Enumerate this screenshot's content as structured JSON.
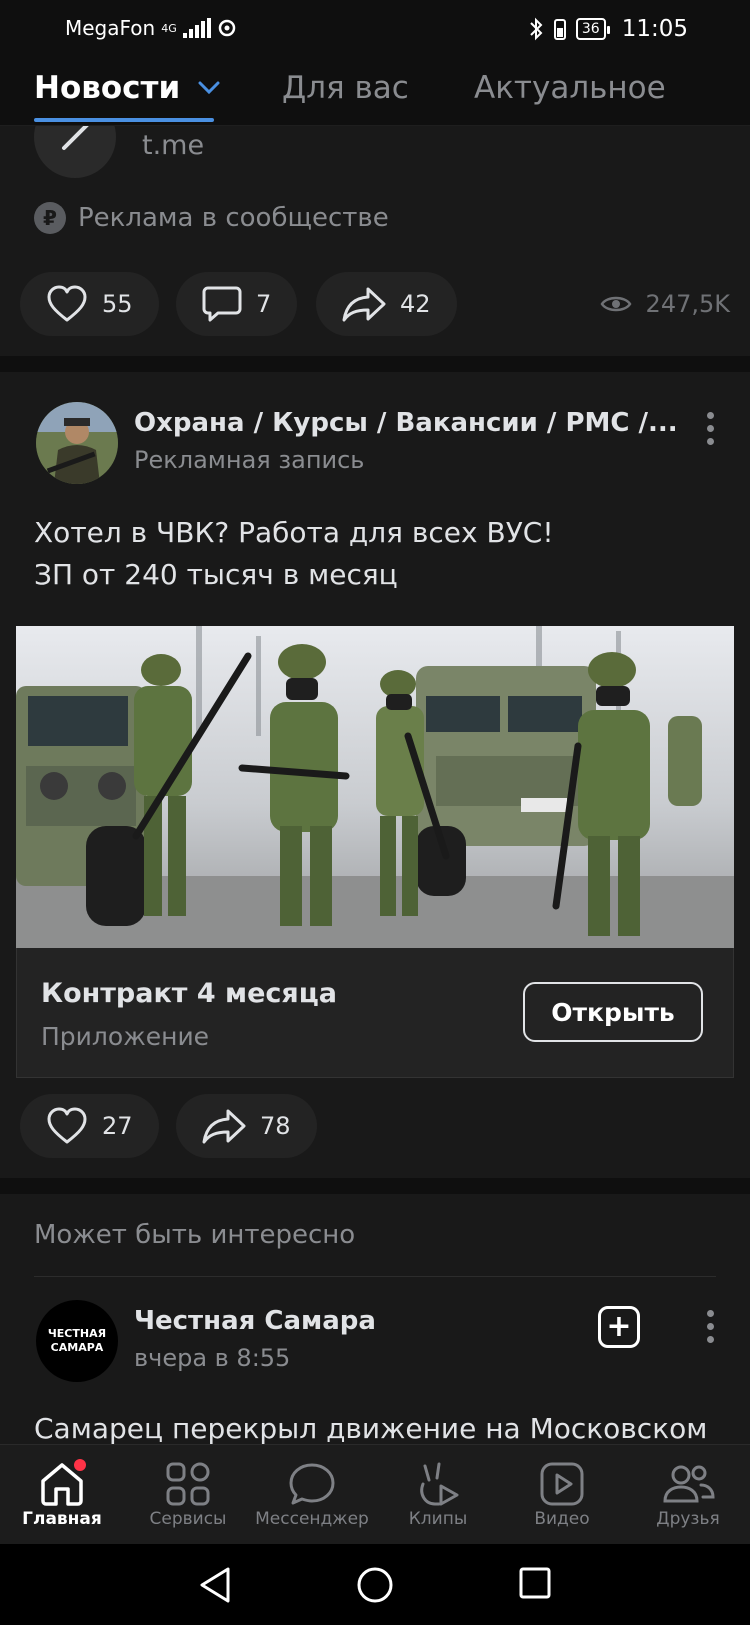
{
  "status_bar": {
    "carrier": "MegaFon",
    "network": "4G",
    "battery": "36",
    "time": "11:05"
  },
  "tabs": [
    {
      "label": "Новости",
      "active": true
    },
    {
      "label": "Для вас",
      "active": false
    },
    {
      "label": "Актуальное",
      "active": false
    }
  ],
  "post1": {
    "link_domain": "t.me",
    "ad_label": "Реклама в сообществе",
    "likes": "55",
    "comments": "7",
    "shares": "42",
    "views": "247,5K"
  },
  "post2": {
    "author": "Охрана / Курсы / Вакансии / РМС /...",
    "subtitle": "Рекламная запись",
    "text_line1": "Хотел в ЧВК? Работа для всех ВУС!",
    "text_line2": "ЗП от 240 тысяч в месяц",
    "card_title": "Контракт 4 месяца",
    "card_subtitle": "Приложение",
    "open_button": "Открыть",
    "likes": "27",
    "shares": "78"
  },
  "recommendations": {
    "header": "Может быть интересно",
    "author": "Честная Самара",
    "avatar_text_line1": "ЧЕСТНАЯ",
    "avatar_text_line2": "САМАРА",
    "time": "вчера в 8:55",
    "text": "Самарец перекрыл движение на Московском"
  },
  "bottom_nav": [
    {
      "label": "Главная",
      "icon": "home-icon",
      "active": true,
      "badge": true
    },
    {
      "label": "Сервисы",
      "icon": "services-icon",
      "active": false
    },
    {
      "label": "Мессенджер",
      "icon": "messenger-icon",
      "active": false
    },
    {
      "label": "Клипы",
      "icon": "clips-icon",
      "active": false
    },
    {
      "label": "Видео",
      "icon": "video-icon",
      "active": false
    },
    {
      "label": "Друзья",
      "icon": "friends-icon",
      "active": false
    }
  ],
  "colors": {
    "accent": "#4a90e2",
    "background": "#0f0f0f",
    "card": "#191919",
    "badge": "#ff3347"
  }
}
